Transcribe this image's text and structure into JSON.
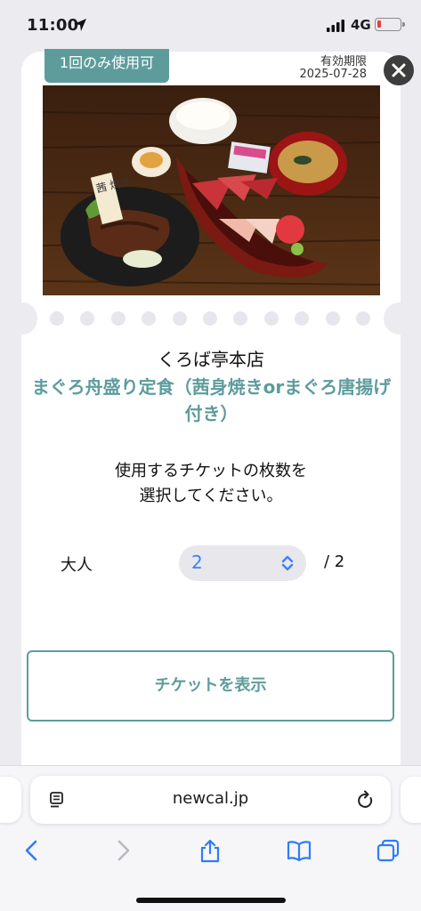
{
  "status_bar": {
    "time": "11:00",
    "network": "4G",
    "battery_color": "#e8413a"
  },
  "ticket": {
    "badge": "1回のみ使用可",
    "expiry_label": "有効期限",
    "expiry_date": "2025-07-28",
    "store_name": "くろば亭本店",
    "menu_title": "まぐろ舟盛り定食（茜身焼きorまぐろ唐揚げ付き）",
    "prompt_line1": "使用するチケットの枚数を",
    "prompt_line2": "選択してください。",
    "adult_label": "大人",
    "quantity_value": "2",
    "quantity_max": "/ 2",
    "show_button": "チケットを表示",
    "photo_sign": "茜 焼き",
    "accent_color": "#5e9c9c"
  },
  "browser": {
    "url": "newcal.jp"
  },
  "icons": {
    "location": "location-arrow-icon",
    "signal": "signal-icon",
    "battery": "battery-icon",
    "close": "close-icon",
    "select": "chevron-updown-icon",
    "reader": "reader-mode-icon",
    "reload": "reload-icon",
    "back": "back-icon",
    "forward": "forward-icon",
    "share": "share-icon",
    "bookmarks": "bookmarks-icon",
    "tabs": "tabs-icon"
  }
}
